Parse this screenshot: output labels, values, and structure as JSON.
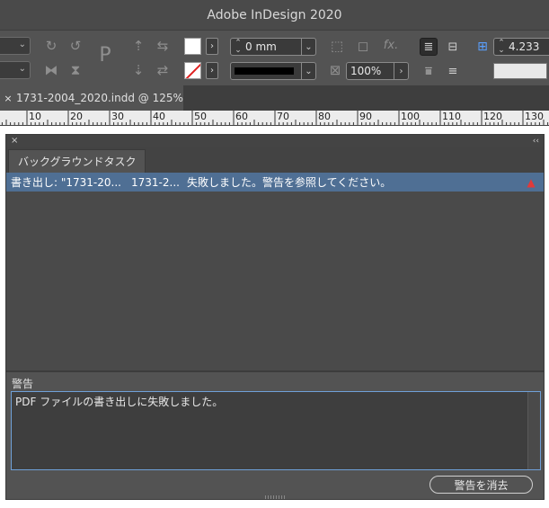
{
  "app": {
    "title": "Adobe InDesign 2020"
  },
  "control_panel": {
    "offset_value": "0 mm",
    "zoom_value": "100%",
    "right_value": "4.233",
    "fx_label": "fx."
  },
  "document_tab": {
    "close_label": "×",
    "title": "1731-2004_2020.indd @ 125%"
  },
  "ruler": {
    "labels": [
      "10",
      "20",
      "30",
      "40",
      "50",
      "60",
      "70",
      "80",
      "90",
      "100",
      "110",
      "120",
      "130"
    ]
  },
  "panel": {
    "close_label": "×",
    "collapse_label": "‹‹",
    "tab_label": "バックグラウンドタスク",
    "tasks": [
      {
        "name": "書き出し: \"1731-20...",
        "file": "1731-2...",
        "status": "失敗しました。警告を参照してください。"
      }
    ],
    "warning_label": "警告",
    "warning_text": "PDF ファイルの書き出しに失敗しました。",
    "clear_button": "警告を消去"
  },
  "colors": {
    "selection": "#4f6f94",
    "warning_icon": "#e03a3a"
  }
}
